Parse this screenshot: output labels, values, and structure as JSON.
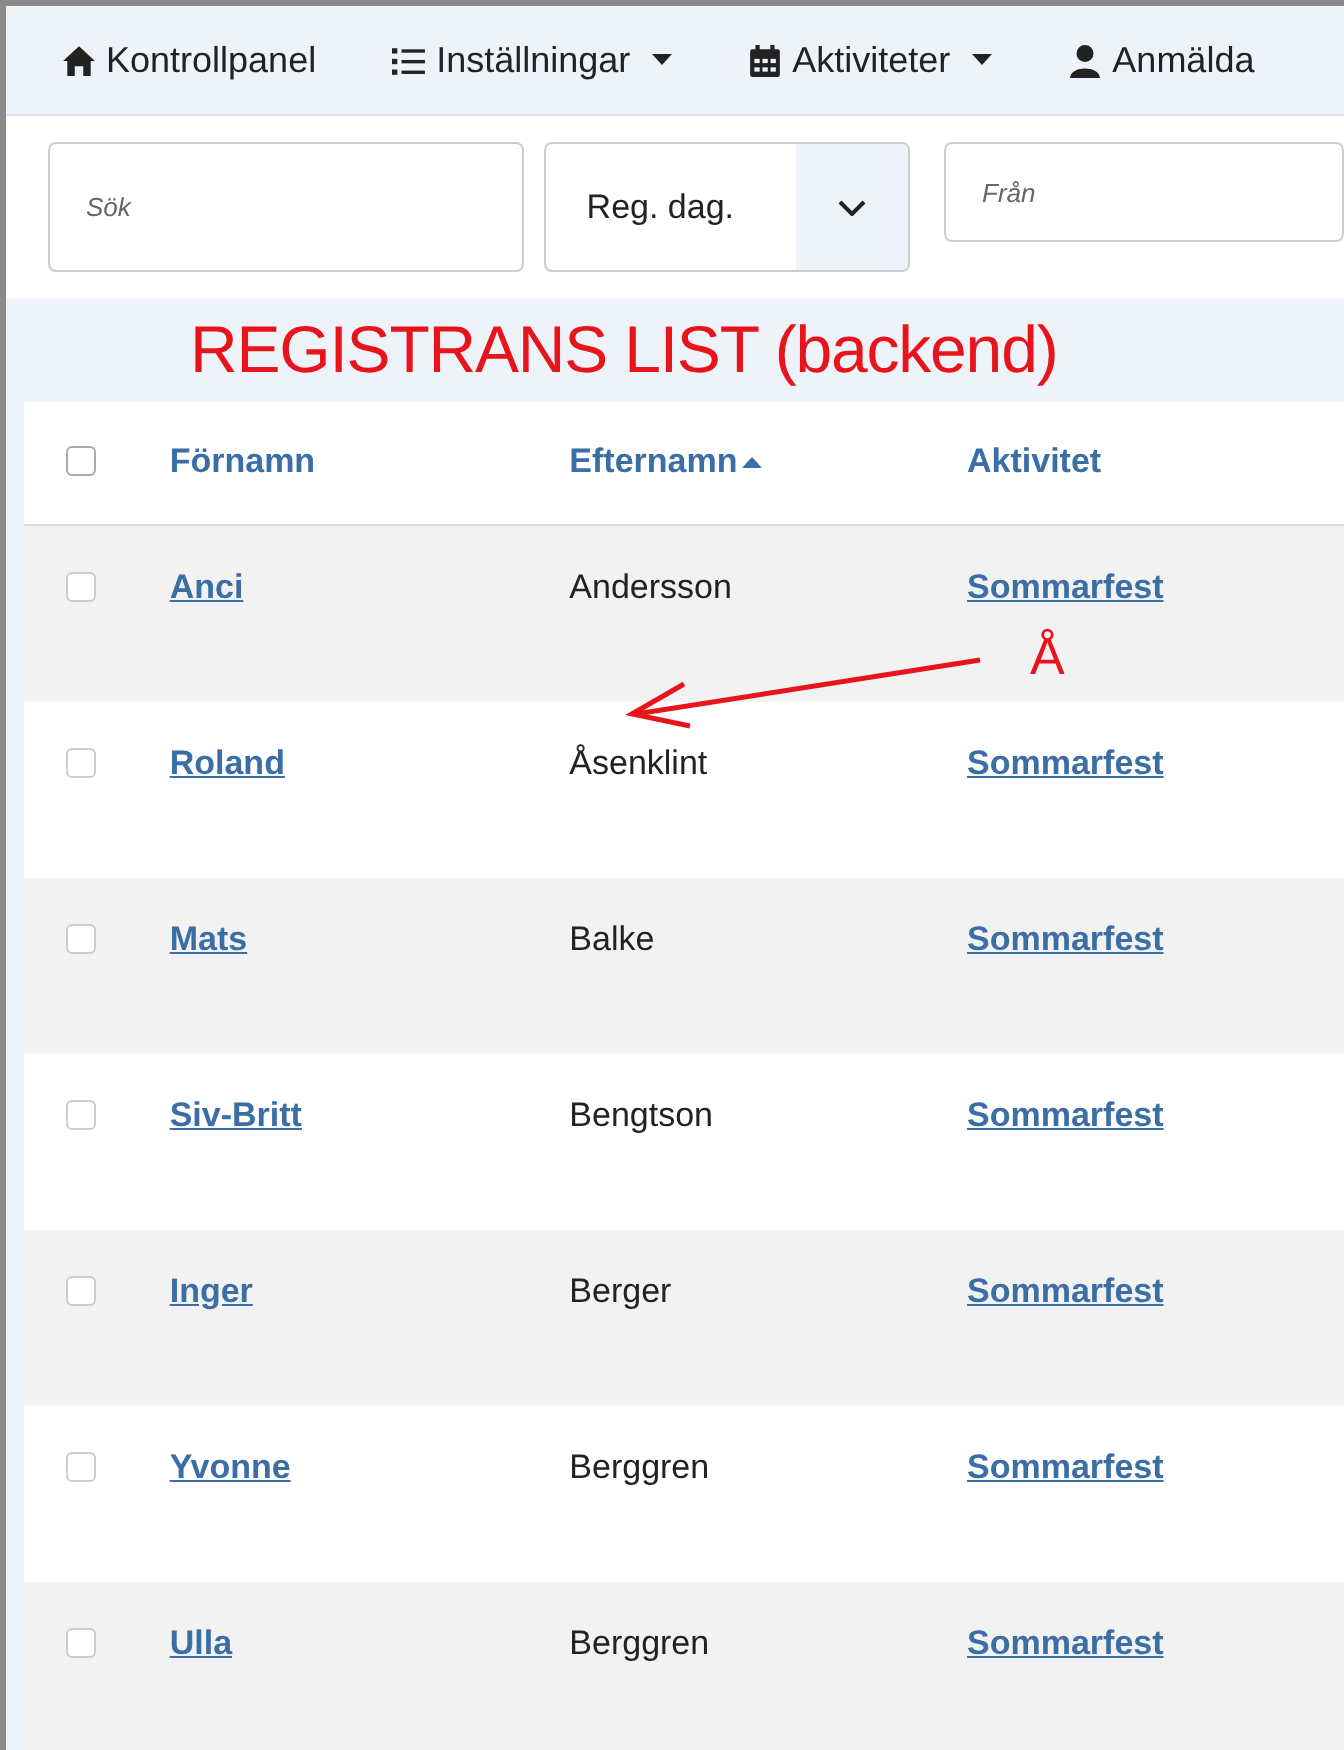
{
  "nav": [
    {
      "kind": "home",
      "label": "Kontrollpanel",
      "dropdown": false
    },
    {
      "kind": "list",
      "label": "Inställningar",
      "dropdown": true
    },
    {
      "kind": "calendar",
      "label": "Aktiviteter",
      "dropdown": true
    },
    {
      "kind": "user",
      "label": "Anmälda",
      "dropdown": false
    }
  ],
  "filters": {
    "search": {
      "placeholder": "Sök"
    },
    "select": {
      "value": "Reg. dag."
    },
    "date": {
      "placeholder": "Från"
    }
  },
  "title": "REGISTRANS LIST (backend)",
  "table": {
    "select_all": {
      "checked": false
    },
    "columns": [
      {
        "label": "Förnamn",
        "sorted": false
      },
      {
        "label": "Efternamn",
        "sorted": true
      },
      {
        "label": "Aktivitet",
        "sorted": false
      }
    ],
    "rows": [
      {
        "checked": false,
        "first": "Anci",
        "last": "Andersson",
        "activity": "Sommarfest"
      },
      {
        "checked": false,
        "first": "Roland",
        "last": "Åsenklint",
        "activity": "Sommarfest"
      },
      {
        "checked": false,
        "first": "Mats",
        "last": "Balke",
        "activity": "Sommarfest"
      },
      {
        "checked": false,
        "first": "Siv-Britt",
        "last": "Bengtson",
        "activity": "Sommarfest"
      },
      {
        "checked": false,
        "first": "Inger",
        "last": "Berger",
        "activity": "Sommarfest"
      },
      {
        "checked": false,
        "first": "Yvonne",
        "last": "Berggren",
        "activity": "Sommarfest"
      },
      {
        "checked": false,
        "first": "Ulla",
        "last": "Berggren",
        "activity": "Sommarfest"
      }
    ]
  },
  "annotation": {
    "text": "Å"
  }
}
